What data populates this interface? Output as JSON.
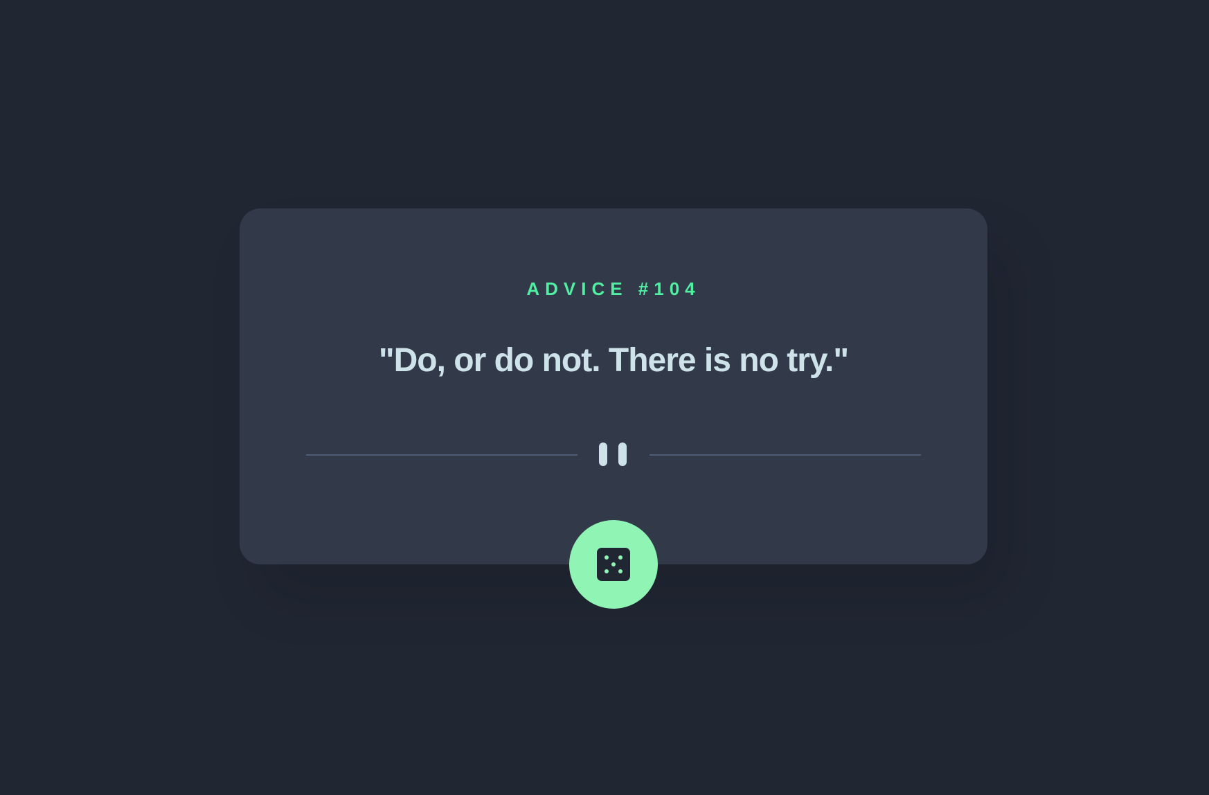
{
  "advice": {
    "label": "ADVICE #104",
    "quote": "\"Do, or do not. There is no try.\""
  },
  "divider": {
    "icon": "pause-icon"
  },
  "dice_button": {
    "icon": "dice-icon",
    "accessible_label": ""
  },
  "colors": {
    "background": "#202632",
    "card": "#323a49",
    "accent": "#53ffaa",
    "button": "#8ff4b4",
    "quote_text": "#cee3e9",
    "divider_line": "#4f5d74"
  }
}
